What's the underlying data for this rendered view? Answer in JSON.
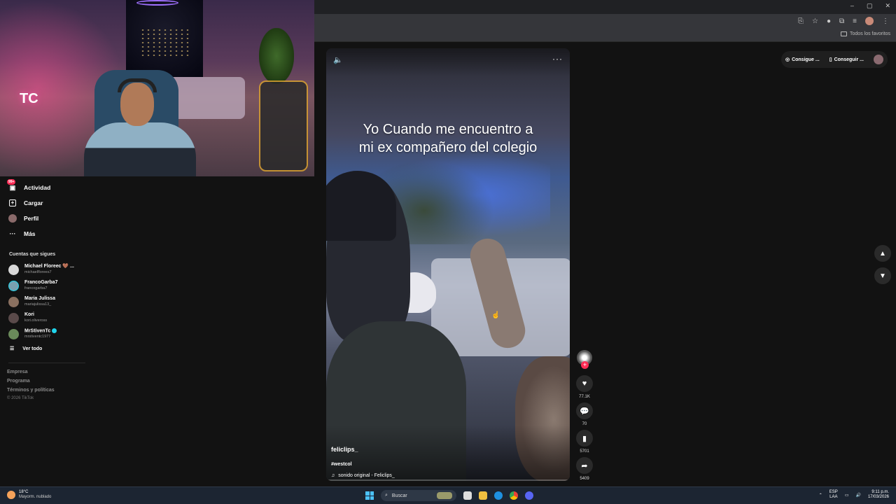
{
  "browser": {
    "window_controls": [
      "–",
      "▢",
      "✕"
    ],
    "bookmarks_all": "Todos los favoritos"
  },
  "sidebar": {
    "nav": [
      {
        "label": "Actividad",
        "badge": "99+",
        "icon": "inbox-icon"
      },
      {
        "label": "Cargar",
        "icon": "upload-plus-icon"
      },
      {
        "label": "Perfil",
        "icon": "profile-avatar"
      },
      {
        "label": "Más",
        "icon": "more-dots-icon"
      }
    ],
    "following_title": "Cuentas que sigues",
    "following": [
      {
        "name": "Michael Floreес 🤎 ...",
        "handle": "michaelflorees7"
      },
      {
        "name": "FrancoGarba7",
        "handle": "francogarba7"
      },
      {
        "name": "Maria Julissa",
        "handle": "mariajulissa13_"
      },
      {
        "name": "Kori",
        "handle": "kori.oliveross"
      },
      {
        "name": "MrStivenTc",
        "handle": "mrstiventc1977",
        "verified": true
      }
    ],
    "see_all": "Ver todo",
    "footer_links": [
      "Empresa",
      "Programa",
      "Términos y políticas"
    ],
    "copyright": "© 2026 TikTok"
  },
  "video": {
    "caption_line1": "Yo Cuando me encuentro a",
    "caption_line2": "mi ex compañero del colegio",
    "author": "feliclips_",
    "hashtag": "#westcol",
    "sound": "sonido original - Feliclips_"
  },
  "actions": {
    "likes": "77.1K",
    "comments": "70",
    "saves": "5701",
    "shares": "5409"
  },
  "top_right": {
    "pill1": "Consigue ...",
    "pill2": "Conseguir ..."
  },
  "taskbar": {
    "temp": "18°C",
    "weather": "Mayorm. nublado",
    "search": "Buscar",
    "lang1": "ESP",
    "lang2": "LAA",
    "time": "9:11 p.m.",
    "date": "17/03/2026"
  },
  "colors": {
    "accent": "#fe2c55",
    "verified": "#20d5ec",
    "windows_blue": "#4cc2ff"
  }
}
